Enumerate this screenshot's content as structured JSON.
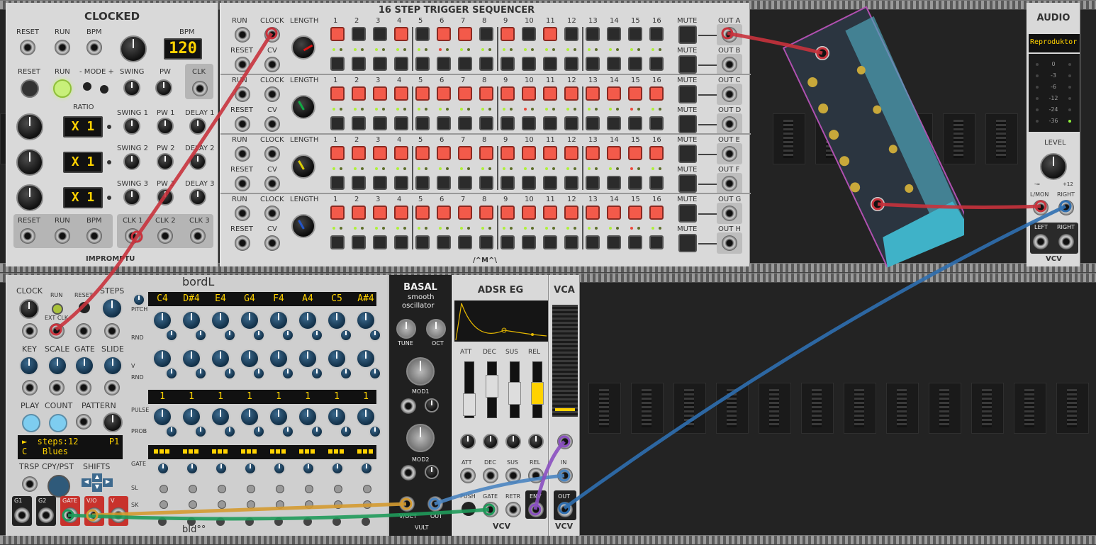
{
  "clocked": {
    "title": "CLOCKED",
    "reset": "RESET",
    "run": "RUN",
    "bpm_label": "BPM",
    "bpm_display_label": "BPM",
    "bpm_value": "120",
    "reset2": "RESET",
    "run2": "RUN",
    "mode": "- MODE +",
    "swing": "SWING",
    "pw": "PW",
    "clk": "CLK",
    "ratio": "RATIO",
    "rows": [
      {
        "display": "X 1",
        "swing": "SWING 1",
        "pw": "PW 1",
        "delay": "DELAY 1"
      },
      {
        "display": "X 1",
        "swing": "SWING 2",
        "pw": "PW 2",
        "delay": "DELAY 2"
      },
      {
        "display": "X 1",
        "swing": "SWING 3",
        "pw": "PW 3",
        "delay": "DELAY 3"
      }
    ],
    "out_reset": "RESET",
    "out_run": "RUN",
    "out_bpm": "BPM",
    "clk1": "CLK 1",
    "clk2": "CLK 2",
    "clk3": "CLK 3",
    "brand": "IMPROMPTU"
  },
  "sequencer": {
    "title": "16 STEP TRIGGER SEQUENCER",
    "run": "RUN",
    "clock": "CLOCK",
    "length": "LENGTH",
    "reset": "RESET",
    "cv": "CV",
    "mute": "MUTE",
    "steps": [
      "1",
      "2",
      "3",
      "4",
      "5",
      "6",
      "7",
      "8",
      "9",
      "10",
      "11",
      "12",
      "13",
      "14",
      "15",
      "16"
    ],
    "outs": [
      "OUT A",
      "OUT B",
      "OUT C",
      "OUT D",
      "OUT E",
      "OUT F",
      "OUT G",
      "OUT H"
    ],
    "brand": "/^M^\\"
  },
  "audio": {
    "title": "AUDIO",
    "device": "Reproduktor",
    "meter": [
      "0",
      "-3",
      "-6",
      "-12",
      "-24",
      "-36"
    ],
    "level": "LEVEL",
    "level_min": "-∞",
    "level_max": "+12",
    "lmon": "L/MON",
    "right": "RIGHT",
    "left2": "LEFT",
    "right2": "RIGHT",
    "brand": "VCV"
  },
  "bordl": {
    "title": "bordL",
    "clock": "CLOCK",
    "run": "RUN",
    "reset": "RESET",
    "steps": "STEPS",
    "ext": "EXT CLK",
    "key": "KEY",
    "scale": "SCALE",
    "gate": "GATE",
    "slide": "SLIDE",
    "play": "PLAY",
    "count": "COUNT",
    "pattern": "PATTERN",
    "lcd_line1": "►  steps:12      P1",
    "lcd_line2": "C   Blues",
    "trsp": "TRSP",
    "cpypst": "CPY/PST",
    "shifts": "SHIFTS",
    "outs": [
      "G1",
      "G2",
      "GATE",
      "V/O",
      "V"
    ],
    "notes": [
      "C4",
      "D#4",
      "E4",
      "G4",
      "F4",
      "A4",
      "C5",
      "A#4"
    ],
    "pulses": [
      "1",
      "1",
      "1",
      "1",
      "1",
      "1",
      "1",
      "1"
    ],
    "row_pitch": "PITCH",
    "row_rnd": "RND",
    "row_v": "V",
    "row_rnd2": "RND",
    "row_pulse": "PULSE",
    "row_prob": "PROB",
    "row_gate": "GATE",
    "row_sl": "SL",
    "row_sk": "SK",
    "brand": "bId°°"
  },
  "basal": {
    "title": "BASAL",
    "sub1": "smooth",
    "sub2": "oscillator",
    "tune": "TUNE",
    "oct": "OCT",
    "mod1": "MOD1",
    "mod2": "MOD2",
    "voct": "V/OCT",
    "out": "OUT",
    "brand": "VULT"
  },
  "adsr": {
    "title": "ADSR EG",
    "att": "ATT",
    "dec": "DEC",
    "sus": "SUS",
    "rel": "REL",
    "att2": "ATT",
    "dec2": "DEC",
    "sus2": "SUS",
    "rel2": "REL",
    "push": "PUSH",
    "gate": "GATE",
    "retr": "RETR",
    "env": "ENV",
    "brand": "VCV"
  },
  "vca": {
    "title": "VCA",
    "in": "IN",
    "out": "OUT",
    "brand": "VCV"
  },
  "colors": {
    "red": "#c8323c",
    "blue": "#2f6fb0",
    "green": "#1f9a5a",
    "orange": "#d49a30",
    "purple": "#8a4fc0"
  }
}
